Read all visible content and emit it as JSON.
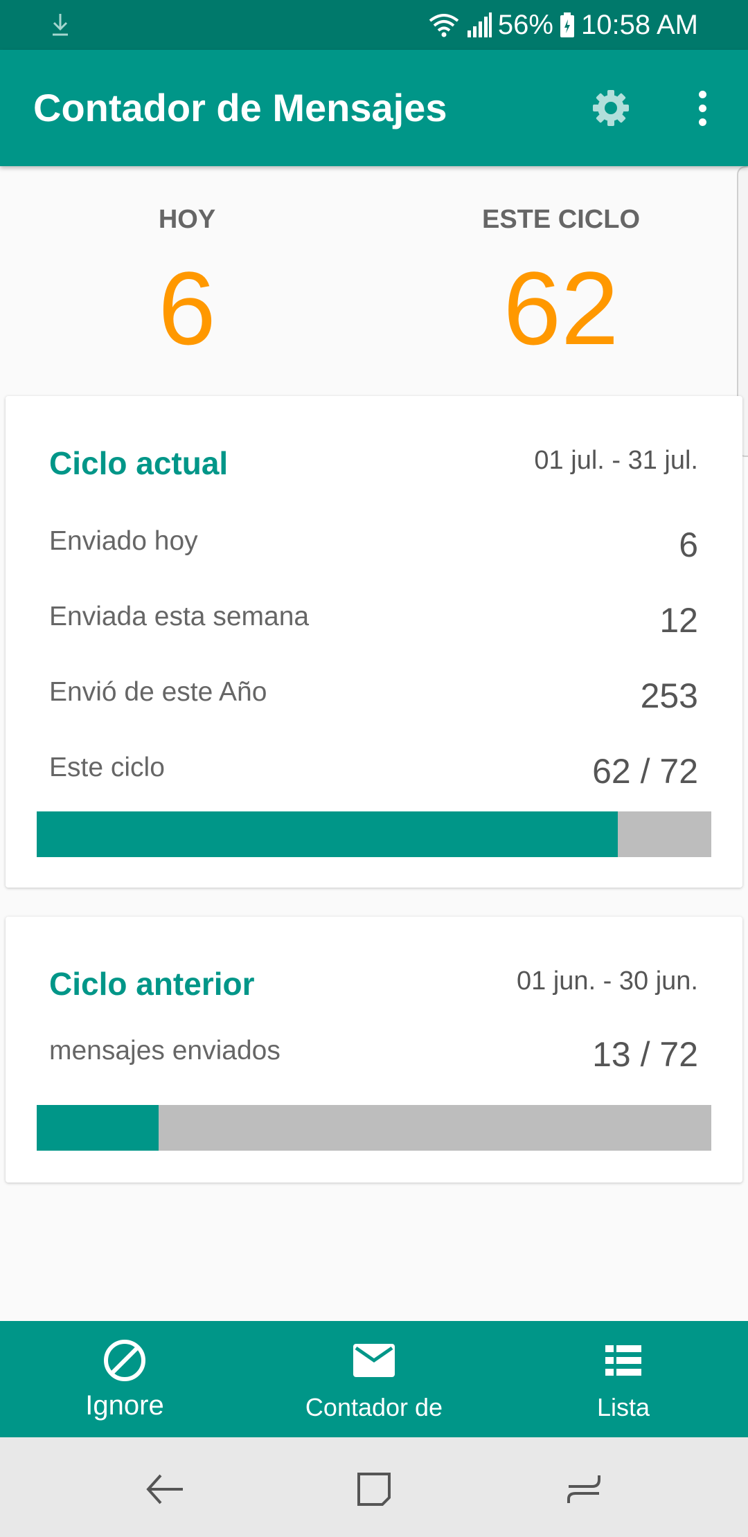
{
  "status_bar": {
    "battery": "56%",
    "time": "10:58 AM",
    "icons": [
      "download-icon",
      "wifi-icon",
      "signal-icon",
      "battery-icon"
    ]
  },
  "app_bar": {
    "title": "Contador de Mensajes",
    "actions": [
      "gear-icon",
      "overflow-menu-icon"
    ]
  },
  "summary": {
    "today_label": "HOY",
    "today_value": "6",
    "cycle_label": "ESTE CICLO",
    "cycle_value": "62"
  },
  "current_cycle": {
    "title": "Ciclo actual",
    "range": "01 jul. - 31 jul.",
    "rows": [
      {
        "label": "Enviado hoy",
        "value": "6"
      },
      {
        "label": "Enviada esta semana",
        "value": "12"
      },
      {
        "label": "Envió de este Año",
        "value": "253"
      },
      {
        "label": "Este ciclo",
        "value": "62 / 72"
      }
    ],
    "progress_fraction": 0.861
  },
  "previous_cycle": {
    "title": "Ciclo anterior",
    "range": "01 jun. - 30 jun.",
    "label": "mensajes enviados",
    "value": "13 / 72",
    "progress_fraction": 0.181
  },
  "bottom_nav": {
    "items": [
      {
        "label": "Ignore",
        "icon": "block-icon"
      },
      {
        "label": "Contador de",
        "icon": "mail-icon"
      },
      {
        "label": "Lista",
        "icon": "list-icon"
      }
    ]
  },
  "system_nav": [
    "back-icon",
    "home-icon",
    "recents-icon"
  ],
  "colors": {
    "primary": "#009688",
    "primary_dark": "#00796b",
    "accent": "#ff9800",
    "progress_track": "#bdbdbd"
  }
}
